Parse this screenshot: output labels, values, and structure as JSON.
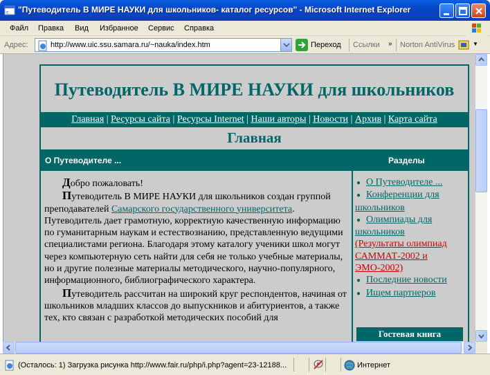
{
  "window": {
    "title": "\"Путеводитель В МИРЕ НАУКИ для школьников- каталог ресурсов\" - Microsoft Internet Explorer"
  },
  "menu": [
    "Файл",
    "Правка",
    "Вид",
    "Избранное",
    "Сервис",
    "Справка"
  ],
  "address": {
    "label": "Адрес:",
    "url": "http://www.uic.ssu.samara.ru/~nauka/index.htm",
    "go_label": "Переход",
    "links_label": "Ссылки",
    "norton_label": "Norton AntiVirus"
  },
  "page": {
    "site_title": "Путеводитель В МИРЕ НАУКИ для школьников",
    "nav": [
      "Главная",
      "Ресурсы сайта",
      "Ресурсы Internet",
      "Наши авторы",
      "Новости",
      "Архив",
      "Карта сайта"
    ],
    "section_title": "Главная",
    "left_header": "О Путеводителе ...",
    "right_header": "Разделы",
    "p1_drop": "Д",
    "p1_text": "обро пожаловать!",
    "p2_drop": "П",
    "p2_text_a": "утеводитель В МИРЕ НАУКИ для школьников создан группой преподавателей ",
    "p2_link": "Самарского государственного университета",
    "p2_text_b": ". Путеводитель дает грамотную, корректную качественную информацию по гуманитарным наукам и естествознанию, представленную ведущими специалистами региона. Благодаря этому каталогу ученики школ могут через компьютерную сеть найти для себя не только учебные материалы, но и другие полезные материалы методического, научно-популярного, информационного, библиографического характера.",
    "p3_drop": "П",
    "p3_text": "утеводитель рассчитан на широкий круг респондентов, начиная от школьников младших классов до выпускников и абитуриентов, а также тех, кто связан с разработкой методических пособий для",
    "sections": {
      "about": "О Путеводителе ...",
      "conferences": "Конференции для школьников",
      "olympiads": "Олимпиады для школьников",
      "olympiad_results": "(Результаты олимпиад САММАТ-2002 и ЭМО-2002)",
      "news": "Последние новости",
      "partners": "Ищем партнеров"
    },
    "guestbook": "Гостевая книга"
  },
  "status": {
    "text": "(Осталось: 1) Загрузка рисунка http://www.fair.ru/php/i.php?agent=23-12188...",
    "zone": "Интернет"
  },
  "colors": {
    "accent": "#006666",
    "page_bg": "#cccccc",
    "highlight_red": "#cc0000"
  }
}
